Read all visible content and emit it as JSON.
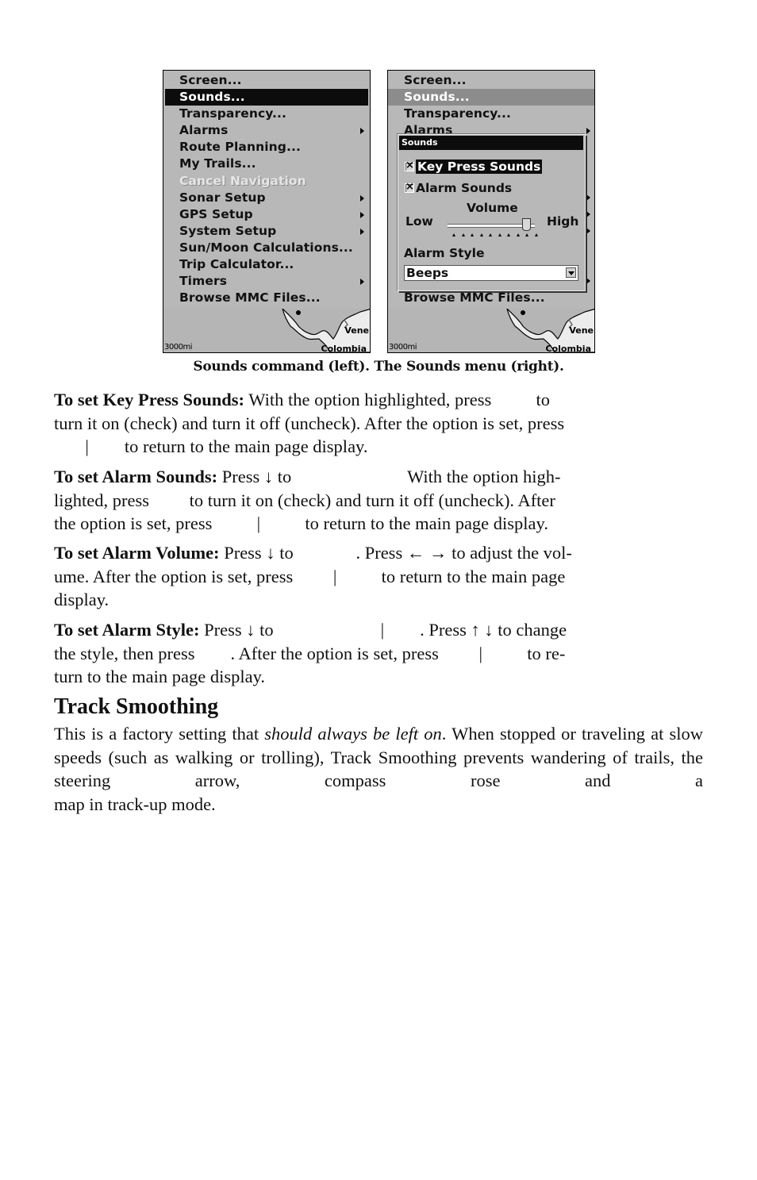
{
  "left_screen": {
    "menu_items": [
      {
        "label": "Screen...",
        "has_submenu": false,
        "state": "normal"
      },
      {
        "label": "Sounds...",
        "has_submenu": false,
        "state": "selected"
      },
      {
        "label": "Transparency...",
        "has_submenu": false,
        "state": "normal"
      },
      {
        "label": "Alarms",
        "has_submenu": true,
        "state": "normal"
      },
      {
        "label": "Route Planning...",
        "has_submenu": false,
        "state": "normal"
      },
      {
        "label": "My Trails...",
        "has_submenu": false,
        "state": "normal"
      },
      {
        "label": "Cancel Navigation",
        "has_submenu": false,
        "state": "disabled"
      },
      {
        "label": "Sonar Setup",
        "has_submenu": true,
        "state": "normal"
      },
      {
        "label": "GPS Setup",
        "has_submenu": true,
        "state": "normal"
      },
      {
        "label": "System Setup",
        "has_submenu": true,
        "state": "normal"
      },
      {
        "label": "Sun/Moon Calculations...",
        "has_submenu": false,
        "state": "normal"
      },
      {
        "label": "Trip Calculator...",
        "has_submenu": false,
        "state": "normal"
      },
      {
        "label": "Timers",
        "has_submenu": true,
        "state": "normal"
      },
      {
        "label": "Browse MMC Files...",
        "has_submenu": false,
        "state": "normal"
      }
    ],
    "map": {
      "scale": "3000mi",
      "labels": [
        "Vene",
        "Colombia"
      ]
    }
  },
  "right_screen": {
    "menu_items_visible": [
      "Screen...",
      "Sounds...",
      "Transparency...",
      "Alarms"
    ],
    "bottom_item": "Browse MMC Files...",
    "dialog": {
      "title": "Sounds",
      "key_press_sounds": {
        "label": "Key Press Sounds",
        "checked": true,
        "selected": true
      },
      "alarm_sounds": {
        "label": "Alarm Sounds",
        "checked": true,
        "selected": false
      },
      "volume": {
        "label": "Volume",
        "low_label": "Low",
        "high_label": "High",
        "level": 0.9
      },
      "alarm_style": {
        "label": "Alarm Style",
        "value": "Beeps"
      }
    },
    "map": {
      "scale": "3000mi",
      "labels": [
        "Vene",
        "Colombia"
      ]
    }
  },
  "caption": "Sounds command (left). The Sounds menu (right).",
  "paragraphs": {
    "key_press": {
      "title": "To set Key Press Sounds:",
      "l1": " With the option highlighted, press          to",
      "l2": "turn it on (check) and turn it off (uncheck). After the option is set, press",
      "l3": "       |        to return to the main page display."
    },
    "alarm_sounds": {
      "title": "To set Alarm Sounds:",
      "l1": " Press ↓ to                          With the option high-",
      "l2": "lighted, press         to turn it on (check) and turn it off (uncheck). After",
      "l3": "the option is set, press          |          to return to the main page display."
    },
    "alarm_volume": {
      "title": "To set Alarm Volume:",
      "l1": " Press ↓ to              . Press ← → to adjust the vol-",
      "l2": "ume. After the option is set, press         |          to return to the main page",
      "l3": "display."
    },
    "alarm_style": {
      "title": "To set Alarm Style:",
      "l1": " Press ↓ to                        |        . Press ↑ ↓ to change",
      "l2": "the style, then press        . After the option is set, press         |          to re-",
      "l3": "turn to the main page display."
    }
  },
  "section": {
    "heading": "Track Smoothing",
    "body_pre": "This is a factory setting that ",
    "body_em": "should always be left on",
    "body_post": ". When stopped or traveling at slow speeds (such as walking or trolling), Track Smoothing prevents wandering of trails, the steering arrow, compass rose and a",
    "body_last": "map in track-up mode."
  }
}
